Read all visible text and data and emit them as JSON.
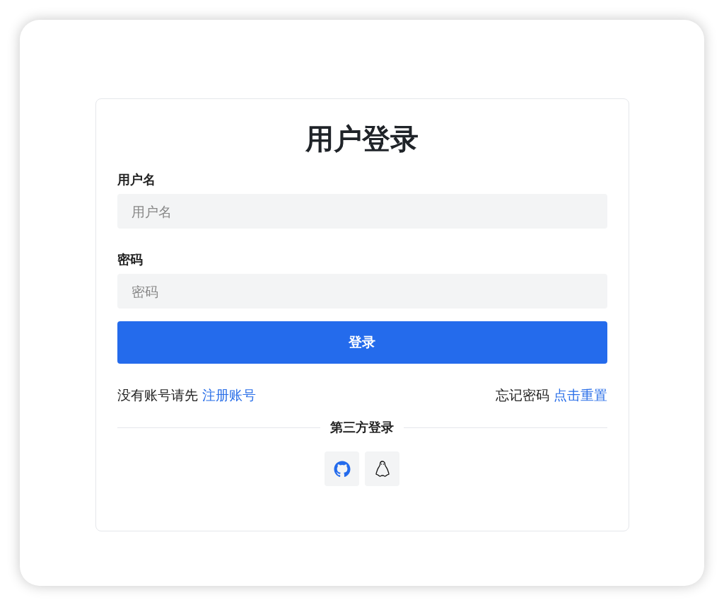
{
  "title": "用户登录",
  "fields": [
    {
      "label": "用户名",
      "placeholder": "用户名"
    },
    {
      "label": "密码",
      "placeholder": "密码"
    }
  ],
  "submit": "登录",
  "register": {
    "text": "没有账号请先",
    "link": "注册账号"
  },
  "forgot": {
    "text": "忘记密码",
    "link": "点击重置"
  },
  "divider": "第三方登录",
  "social": [
    {
      "kind": "github"
    },
    {
      "kind": "penguin"
    }
  ]
}
